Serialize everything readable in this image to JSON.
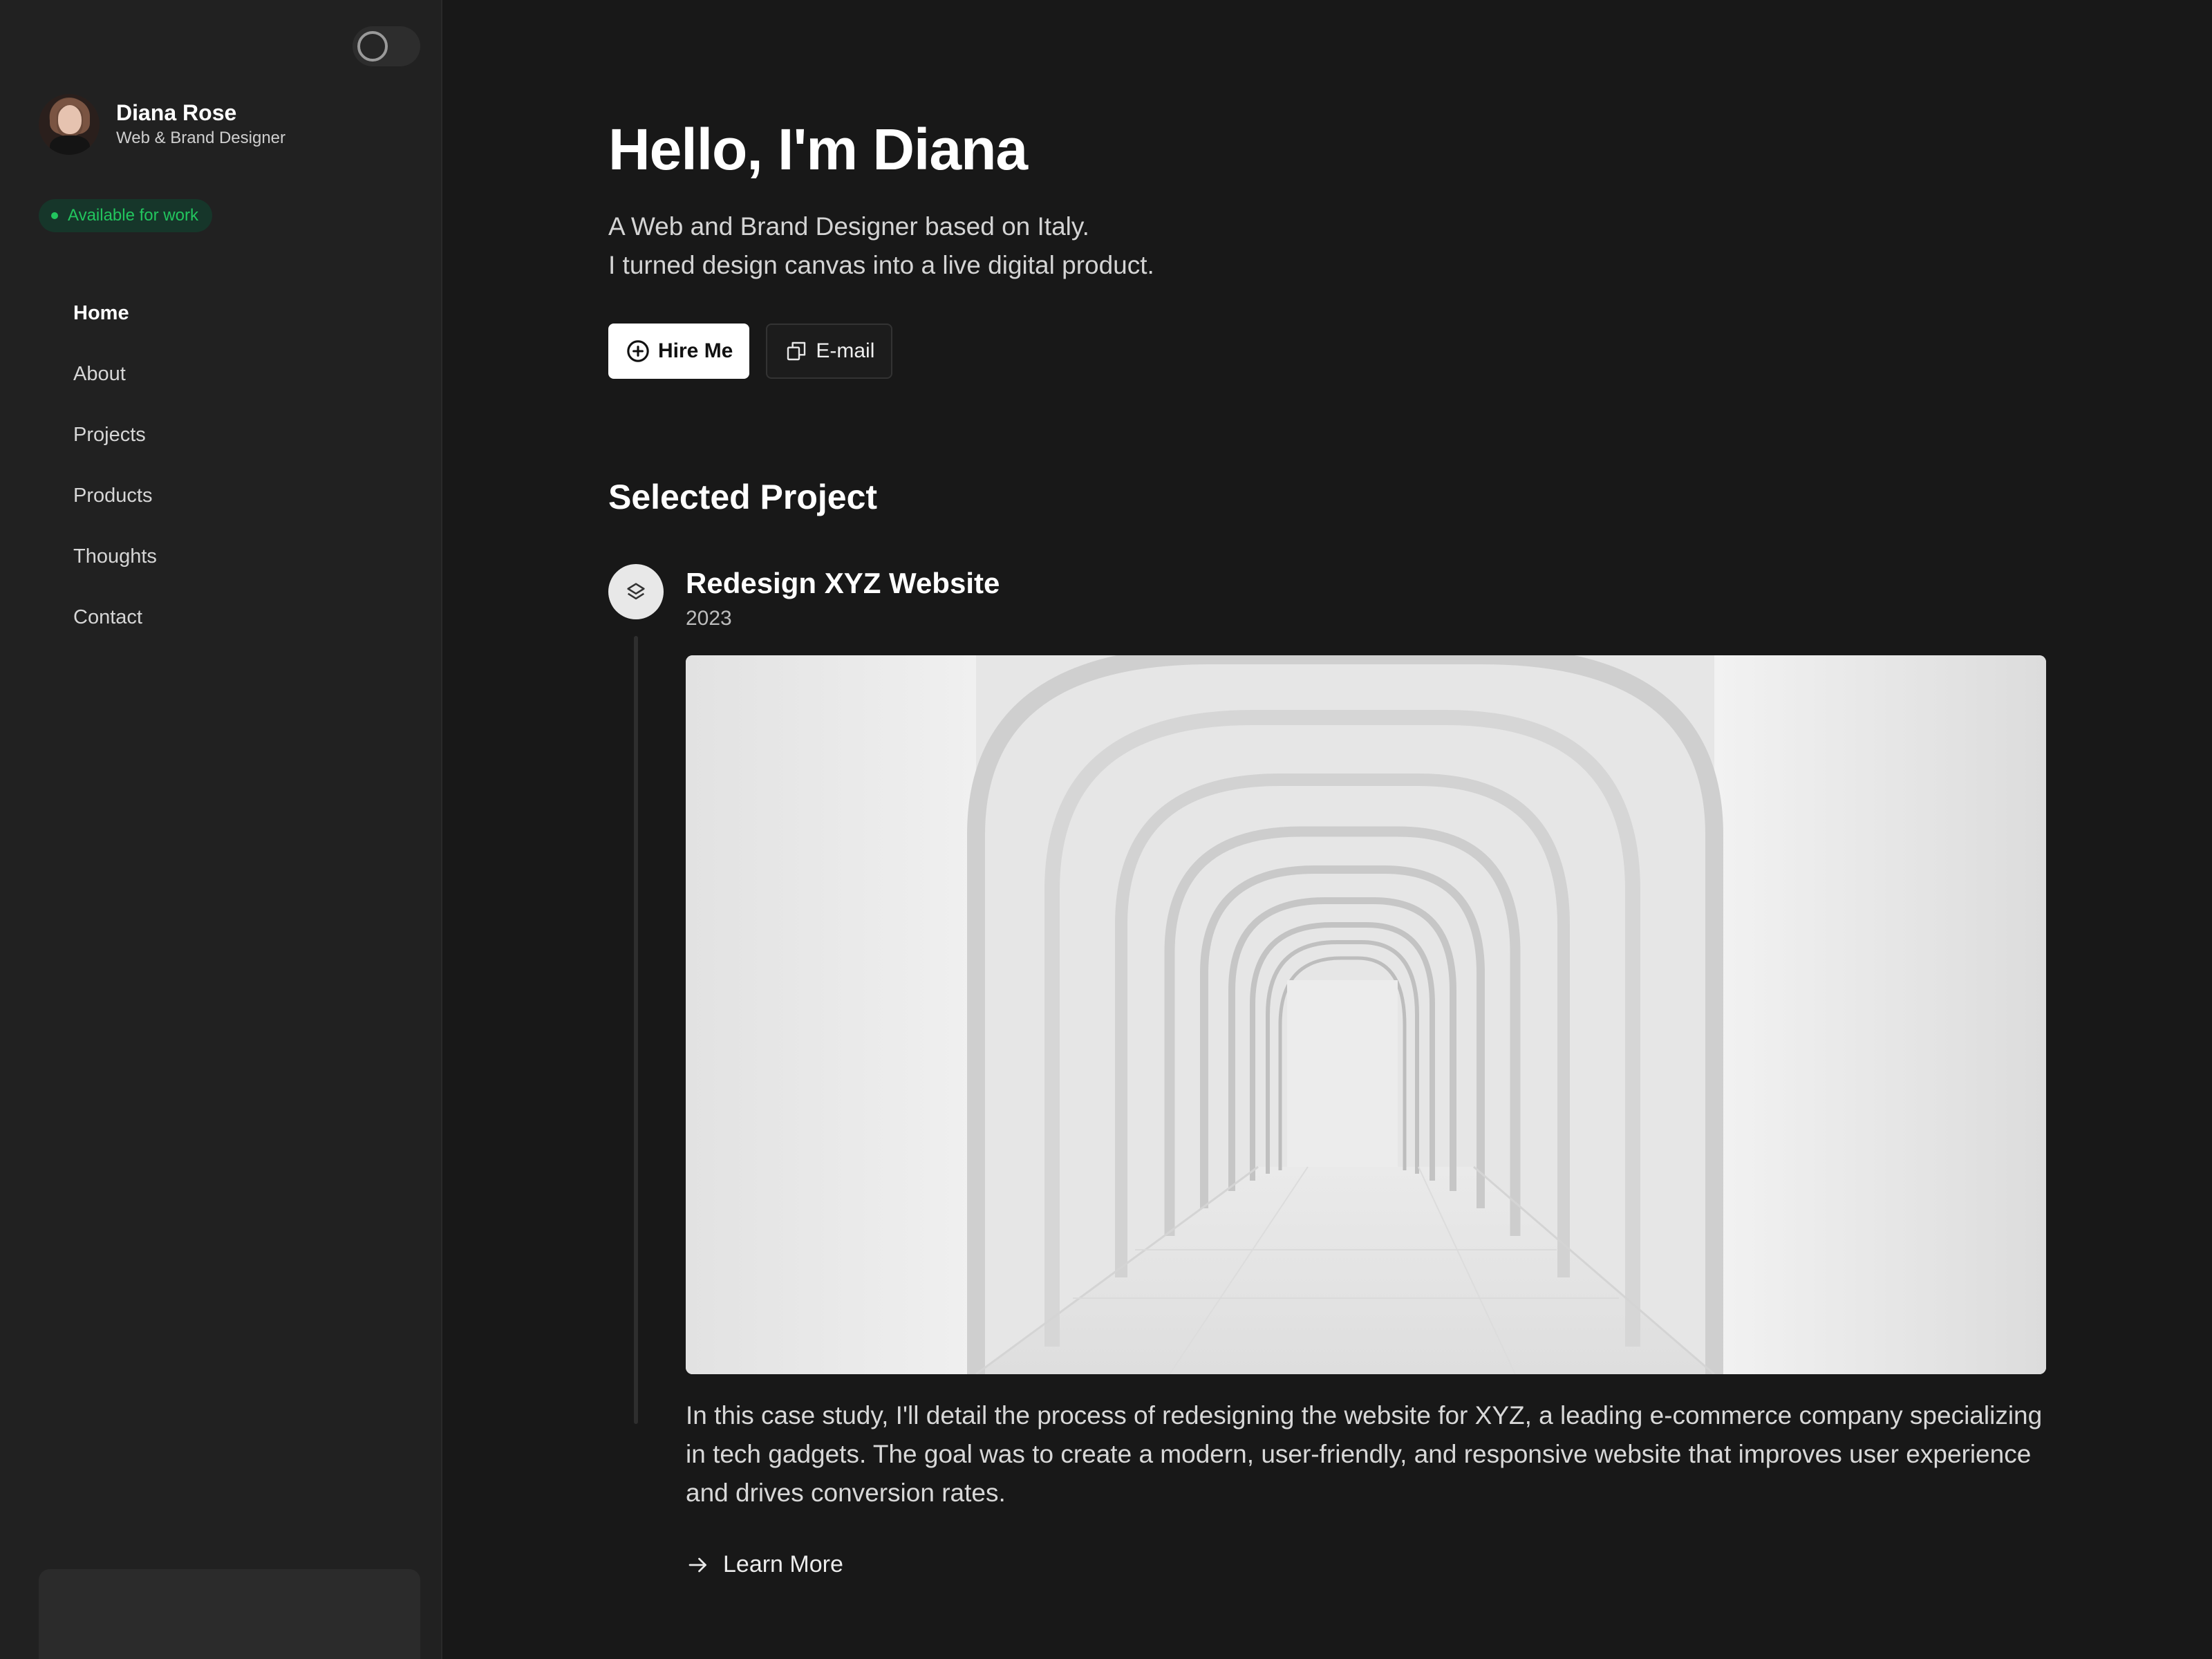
{
  "sidebar": {
    "profile": {
      "name": "Diana Rose",
      "role": "Web & Brand Designer"
    },
    "status": "Available for work",
    "nav": [
      {
        "label": "Home",
        "active": true
      },
      {
        "label": "About",
        "active": false
      },
      {
        "label": "Projects",
        "active": false
      },
      {
        "label": "Products",
        "active": false
      },
      {
        "label": "Thoughts",
        "active": false
      },
      {
        "label": "Contact",
        "active": false
      }
    ]
  },
  "hero": {
    "title": "Hello, I'm Diana",
    "subtitle_line1": "A Web and Brand Designer based on Italy.",
    "subtitle_line2": "I turned design canvas into a live digital product.",
    "primary_button": "Hire Me",
    "secondary_button": "E-mail"
  },
  "selected": {
    "section_title": "Selected Project",
    "project": {
      "title": "Redesign XYZ Website",
      "year": "2023",
      "description": "In this case study, I'll detail the process of redesigning the website for XYZ, a leading e-commerce company specializing in tech gadgets. The goal was to create a modern, user-friendly, and responsive website that improves user experience and drives conversion rates.",
      "link": "Learn More"
    }
  },
  "colors": {
    "background": "#181818",
    "sidebar": "#212121",
    "status_green": "#22c55e"
  }
}
